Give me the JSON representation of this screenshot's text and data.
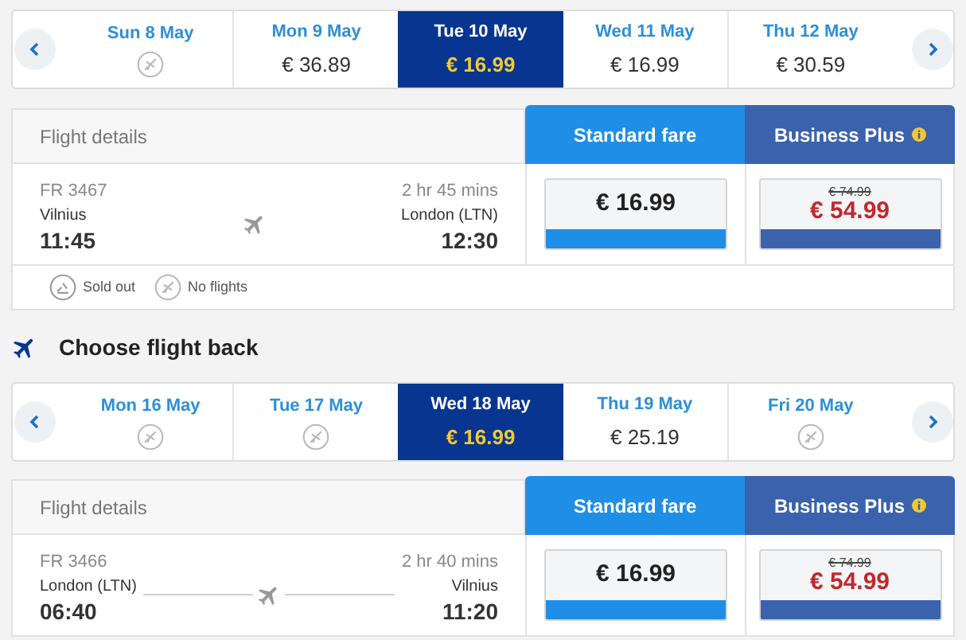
{
  "outbound_dates": [
    {
      "label": "Sun 8 May",
      "kind": "no_flights",
      "selected": false
    },
    {
      "label": "Mon 9 May",
      "kind": "price",
      "price": "€ 36.89",
      "selected": false
    },
    {
      "label": "Tue 10 May",
      "kind": "price",
      "price": "€ 16.99",
      "selected": true
    },
    {
      "label": "Wed 11 May",
      "kind": "price",
      "price": "€ 16.99",
      "selected": false
    },
    {
      "label": "Thu 12 May",
      "kind": "price",
      "price": "€ 30.59",
      "selected": false
    }
  ],
  "outbound": {
    "header": {
      "details": "Flight details",
      "standard": "Standard fare",
      "business": "Business Plus"
    },
    "flight": {
      "number": "FR 3467",
      "duration": "2 hr 45 mins",
      "from": "Vilnius",
      "to": "London (LTN)",
      "depart": "11:45",
      "arrive": "12:30",
      "route_line": false,
      "standard_price": "€ 16.99",
      "business_old_price": "€ 74.99",
      "business_price": "€ 54.99"
    },
    "legend": [
      {
        "kind": "sold_out",
        "label": "Sold out"
      },
      {
        "kind": "no_flights",
        "label": "No flights"
      }
    ]
  },
  "return_title": "Choose flight back",
  "return_dates": [
    {
      "label": "Mon 16 May",
      "kind": "no_flights",
      "selected": false
    },
    {
      "label": "Tue 17 May",
      "kind": "no_flights",
      "selected": false
    },
    {
      "label": "Wed 18 May",
      "kind": "price",
      "price": "€ 16.99",
      "selected": true
    },
    {
      "label": "Thu 19 May",
      "kind": "price",
      "price": "€ 25.19",
      "selected": false
    },
    {
      "label": "Fri 20 May",
      "kind": "no_flights",
      "selected": false
    }
  ],
  "return": {
    "header": {
      "details": "Flight details",
      "standard": "Standard fare",
      "business": "Business Plus"
    },
    "flight": {
      "number": "FR 3466",
      "duration": "2 hr 40 mins",
      "from": "London (LTN)",
      "to": "Vilnius",
      "depart": "06:40",
      "arrive": "11:20",
      "route_line": true,
      "standard_price": "€ 16.99",
      "business_old_price": "€ 74.99",
      "business_price": "€ 54.99"
    }
  }
}
